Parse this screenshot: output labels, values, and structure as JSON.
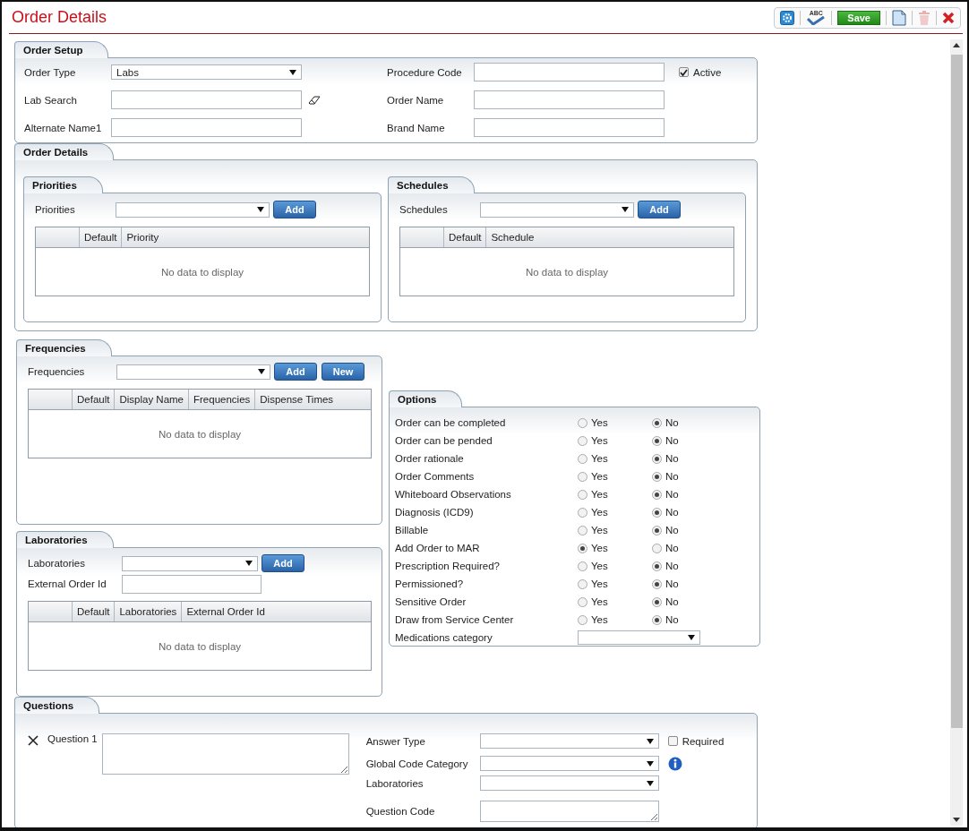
{
  "window": {
    "title": "Order Details"
  },
  "toolbar": [
    {
      "kind": "settings"
    },
    {
      "kind": "spellcheck",
      "label": "ABC"
    },
    {
      "kind": "save",
      "label": "Save"
    },
    {
      "kind": "new"
    },
    {
      "kind": "delete",
      "disabled": true
    },
    {
      "kind": "close"
    }
  ],
  "order_setup": {
    "title": "Order Setup",
    "rows": [
      {
        "left": {
          "label": "Order Type",
          "kind": "select",
          "value": "Labs"
        },
        "right": {
          "label": "Procedure Code",
          "kind": "text"
        },
        "active": {
          "label": "Active",
          "checked": true
        }
      },
      {
        "left": {
          "label": "Lab Search",
          "kind": "text",
          "eraser": true
        },
        "right": {
          "label": "Order Name",
          "kind": "text"
        }
      },
      {
        "left": {
          "label": "Alternate Name1",
          "kind": "text"
        },
        "right": {
          "label": "Brand Name",
          "kind": "text"
        }
      }
    ]
  },
  "order_details": {
    "title": "Order Details",
    "panels": [
      {
        "title": "Priorities",
        "picker_label": "Priorities",
        "buttons": [
          "Add"
        ],
        "columns": [
          "Default",
          "Priority"
        ],
        "empty_text": "No data to display"
      },
      {
        "title": "Schedules",
        "picker_label": "Schedules",
        "buttons": [
          "Add"
        ],
        "columns": [
          "Default",
          "Schedule"
        ],
        "empty_text": "No data to display"
      }
    ]
  },
  "frequencies": {
    "title": "Frequencies",
    "picker_label": "Frequencies",
    "buttons": [
      "Add",
      "New"
    ],
    "columns": [
      "Default",
      "Display Name",
      "Frequencies",
      "Dispense Times"
    ],
    "empty_text": "No data to display"
  },
  "laboratories": {
    "title": "Laboratories",
    "picker_label": "Laboratories",
    "buttons": [
      "Add"
    ],
    "extra_field": {
      "label": "External Order Id"
    },
    "columns": [
      "Default",
      "Laboratories",
      "External Order Id"
    ],
    "empty_text": "No data to display"
  },
  "options": {
    "title": "Options",
    "rows": [
      {
        "label": "Order can be completed",
        "choices": [
          {
            "label": "Yes",
            "selected": false
          },
          {
            "label": "No",
            "selected": true
          }
        ]
      },
      {
        "label": "Order can be pended",
        "choices": [
          {
            "label": "Yes",
            "selected": false
          },
          {
            "label": "No",
            "selected": true
          }
        ]
      },
      {
        "label": "Order rationale",
        "choices": [
          {
            "label": "Yes",
            "selected": false
          },
          {
            "label": "No",
            "selected": true
          }
        ]
      },
      {
        "label": "Order Comments",
        "choices": [
          {
            "label": "Yes",
            "selected": false
          },
          {
            "label": "No",
            "selected": true
          }
        ]
      },
      {
        "label": "Whiteboard Observations",
        "choices": [
          {
            "label": "Yes",
            "selected": false
          },
          {
            "label": "No",
            "selected": true
          }
        ]
      },
      {
        "label": "Diagnosis (ICD9)",
        "choices": [
          {
            "label": "Yes",
            "selected": false
          },
          {
            "label": "No",
            "selected": true
          }
        ]
      },
      {
        "label": "Billable",
        "choices": [
          {
            "label": "Yes",
            "selected": false
          },
          {
            "label": "No",
            "selected": true
          }
        ]
      },
      {
        "label": "Add Order to MAR",
        "choices": [
          {
            "label": "Yes",
            "selected": true
          },
          {
            "label": "No",
            "selected": false
          }
        ]
      },
      {
        "label": "Prescription Required?",
        "choices": [
          {
            "label": "Yes",
            "selected": false
          },
          {
            "label": "No",
            "selected": true
          }
        ]
      },
      {
        "label": "Permissioned?",
        "choices": [
          {
            "label": "Yes",
            "selected": false
          },
          {
            "label": "No",
            "selected": true
          }
        ]
      },
      {
        "label": "Sensitive Order",
        "choices": [
          {
            "label": "Yes",
            "selected": false
          },
          {
            "label": "No",
            "selected": true
          }
        ]
      },
      {
        "label": "Draw from Service Center",
        "choices": [
          {
            "label": "Yes",
            "selected": false
          },
          {
            "label": "No",
            "selected": true
          }
        ]
      }
    ],
    "category": {
      "label": "Medications category"
    }
  },
  "questions": {
    "title": "Questions",
    "items": [
      {
        "label": "Question 1",
        "fields": [
          {
            "label": "Answer Type",
            "kind": "select",
            "required": {
              "label": "Required",
              "checked": false
            }
          },
          {
            "label": "Global Code Category",
            "kind": "select",
            "info": true
          },
          {
            "label": "Laboratories",
            "kind": "select"
          },
          {
            "label": "Question Code",
            "kind": "textarea"
          }
        ]
      }
    ]
  }
}
